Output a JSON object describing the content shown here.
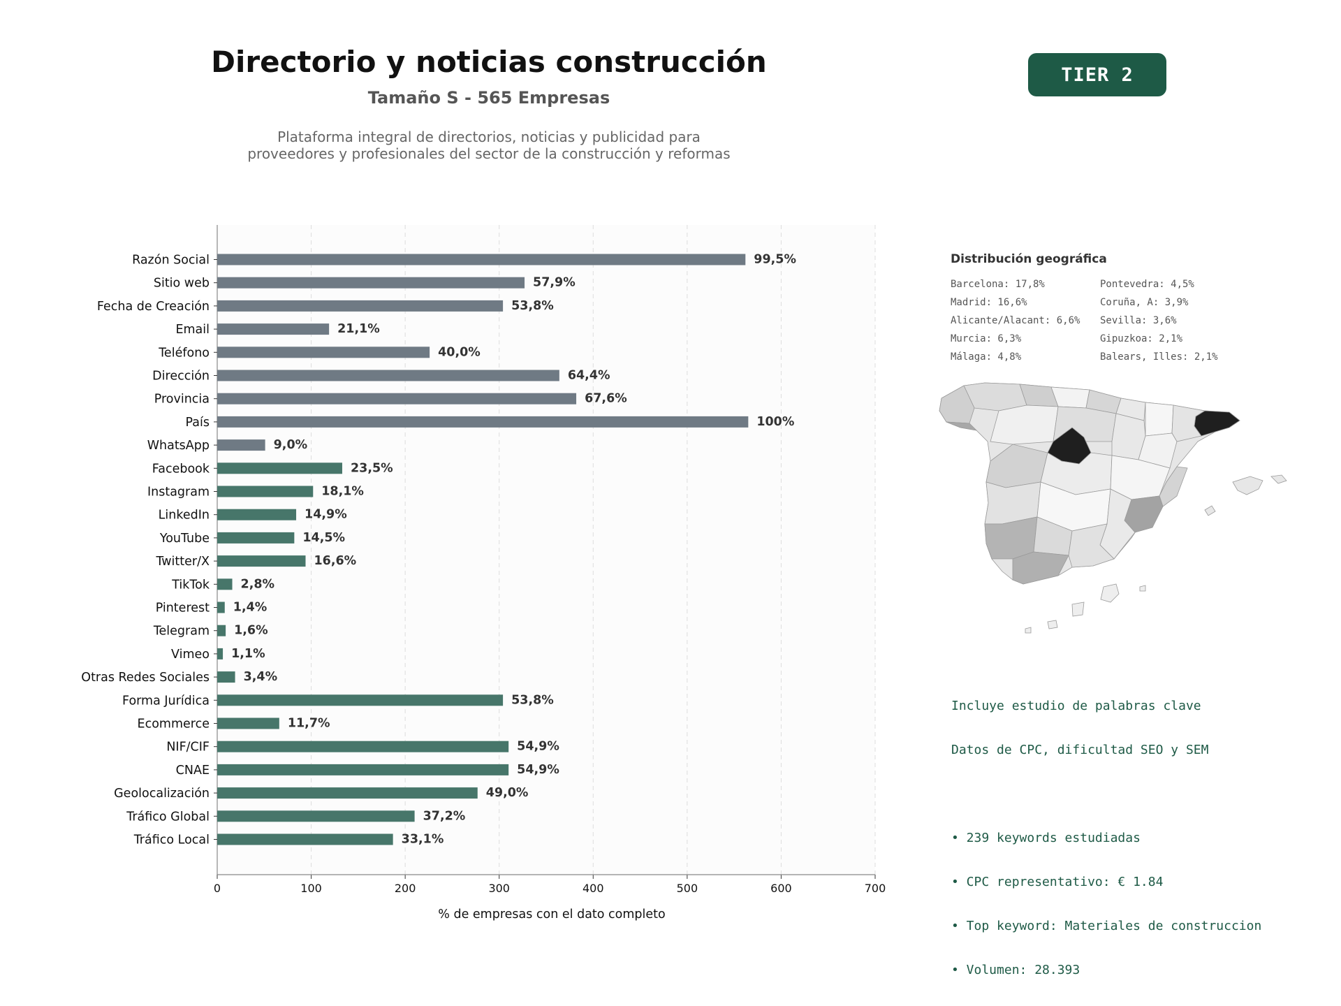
{
  "header": {
    "title": "Directorio y noticias construcción",
    "subtitle": "Tamaño S - 565 Empresas",
    "description_line1": "Plataforma integral de directorios, noticias y publicidad para",
    "description_line2": "proveedores y profesionales del sector de la construcción y reformas",
    "tier_badge": "TIER 2",
    "tier_color": "#1e5a46"
  },
  "chart_data": {
    "type": "bar",
    "orientation": "horizontal",
    "xlabel": "% de empresas con el dato completo",
    "xlim": [
      0,
      700
    ],
    "xticks": [
      0,
      100,
      200,
      300,
      400,
      500,
      600,
      700
    ],
    "grid": "vertical dashed",
    "colors": {
      "contact": "#6f7a84",
      "digital": "#47766a"
    },
    "categories": [
      "Razón Social",
      "Sitio web",
      "Fecha de Creación",
      "Email",
      "Teléfono",
      "Dirección",
      "Provincia",
      "País",
      "WhatsApp",
      "Facebook",
      "Instagram",
      "LinkedIn",
      "YouTube",
      "Twitter/X",
      "TikTok",
      "Pinterest",
      "Telegram",
      "Vimeo",
      "Otras Redes Sociales",
      "Forma Jurídica",
      "Ecommerce",
      "NIF/CIF",
      "CNAE",
      "Geolocalización",
      "Tráfico Global",
      "Tráfico Local"
    ],
    "values": [
      562,
      327,
      304,
      119,
      226,
      364,
      382,
      565,
      51,
      133,
      102,
      84,
      82,
      94,
      16,
      8,
      9,
      6,
      19,
      304,
      66,
      310,
      310,
      277,
      210,
      187
    ],
    "labels": [
      "99,5%",
      "57,9%",
      "53,8%",
      "21,1%",
      "40,0%",
      "64,4%",
      "67,6%",
      "100%",
      "9,0%",
      "23,5%",
      "18,1%",
      "14,9%",
      "14,5%",
      "16,6%",
      "2,8%",
      "1,4%",
      "1,6%",
      "1,1%",
      "3,4%",
      "53,8%",
      "11,7%",
      "54,9%",
      "54,9%",
      "49,0%",
      "37,2%",
      "33,1%"
    ],
    "groups": [
      "contact",
      "contact",
      "contact",
      "contact",
      "contact",
      "contact",
      "contact",
      "contact",
      "contact",
      "digital",
      "digital",
      "digital",
      "digital",
      "digital",
      "digital",
      "digital",
      "digital",
      "digital",
      "digital",
      "digital",
      "digital",
      "digital",
      "digital",
      "digital",
      "digital",
      "digital"
    ]
  },
  "geo": {
    "title": "Distribución geográfica",
    "col1": [
      "Barcelona: 17,8%",
      "Madrid: 16,6%",
      "Alicante/Alacant: 6,6%",
      "Murcia: 6,3%",
      "Málaga: 4,8%"
    ],
    "col2": [
      "Pontevedra: 4,5%",
      "Coruña, A: 3,9%",
      "Sevilla: 3,6%",
      "Gipuzkoa: 2,1%",
      "Balears, Illes: 2,1%"
    ]
  },
  "keywords": {
    "line1": "Incluye estudio de palabras clave",
    "line2": "Datos de CPC, dificultad SEO y SEM",
    "bullet1": "• 239 keywords estudiadas",
    "bullet2": "• CPC representativo: € 1.84",
    "bullet3": "• Top keyword: Materiales de construccion",
    "bullet4": "• Volumen: 28.393"
  }
}
